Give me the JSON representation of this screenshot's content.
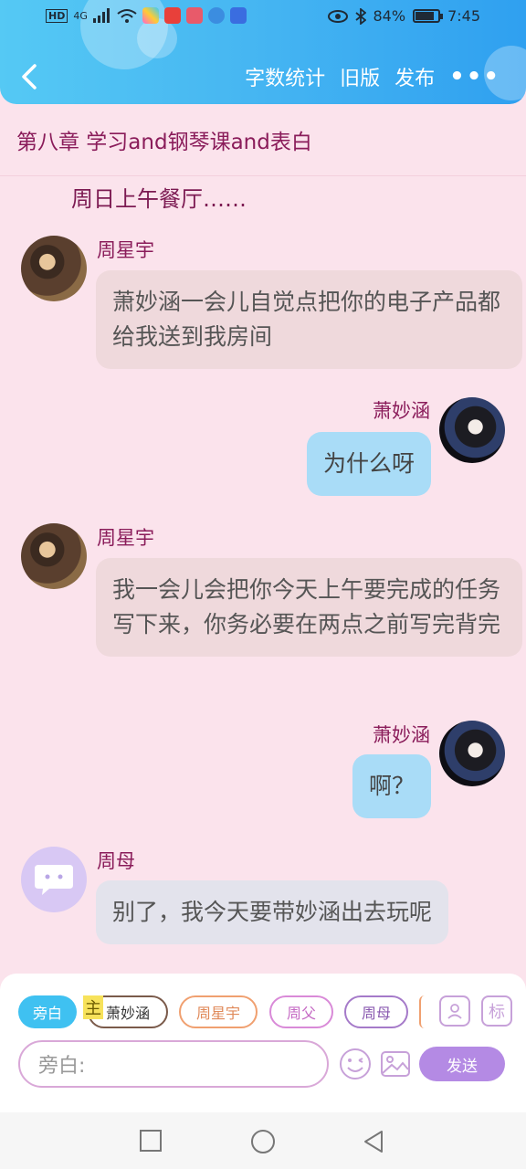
{
  "status": {
    "network": "4G",
    "battery": "84%",
    "time": "7:45"
  },
  "nav": {
    "word_count": "字数统计",
    "old_version": "旧版",
    "publish": "发布",
    "more": "•••"
  },
  "chapter_title": "第八章  学习and钢琴课and表白",
  "narration": "周日上午餐厅……",
  "messages": [
    {
      "speaker": "周星宇",
      "text": "萧妙涵一会儿自觉点把你的电子产品都给我送到我房间"
    },
    {
      "speaker": "萧妙涵",
      "text": "为什么呀"
    },
    {
      "speaker": "周星宇",
      "text": "我一会儿会把你今天上午要完成的任务写下来，你务必要在两点之前写完背完"
    },
    {
      "speaker": "萧妙涵",
      "text": "啊？"
    },
    {
      "speaker": "周母",
      "text": "别了，我今天要带妙涵出去玩呢"
    }
  ],
  "roles": {
    "narrator": "旁白",
    "main_badge": "主",
    "xiao": "萧妙涵",
    "zhou": "周星宇",
    "father": "周父",
    "mother": "周母",
    "mark": "标"
  },
  "input": {
    "placeholder": "旁白:"
  },
  "send_label": "发送",
  "colors": {
    "header": "#47b7f2",
    "background": "#fbe3ec",
    "name": "#8a1c5a",
    "send": "#b48ae4"
  }
}
